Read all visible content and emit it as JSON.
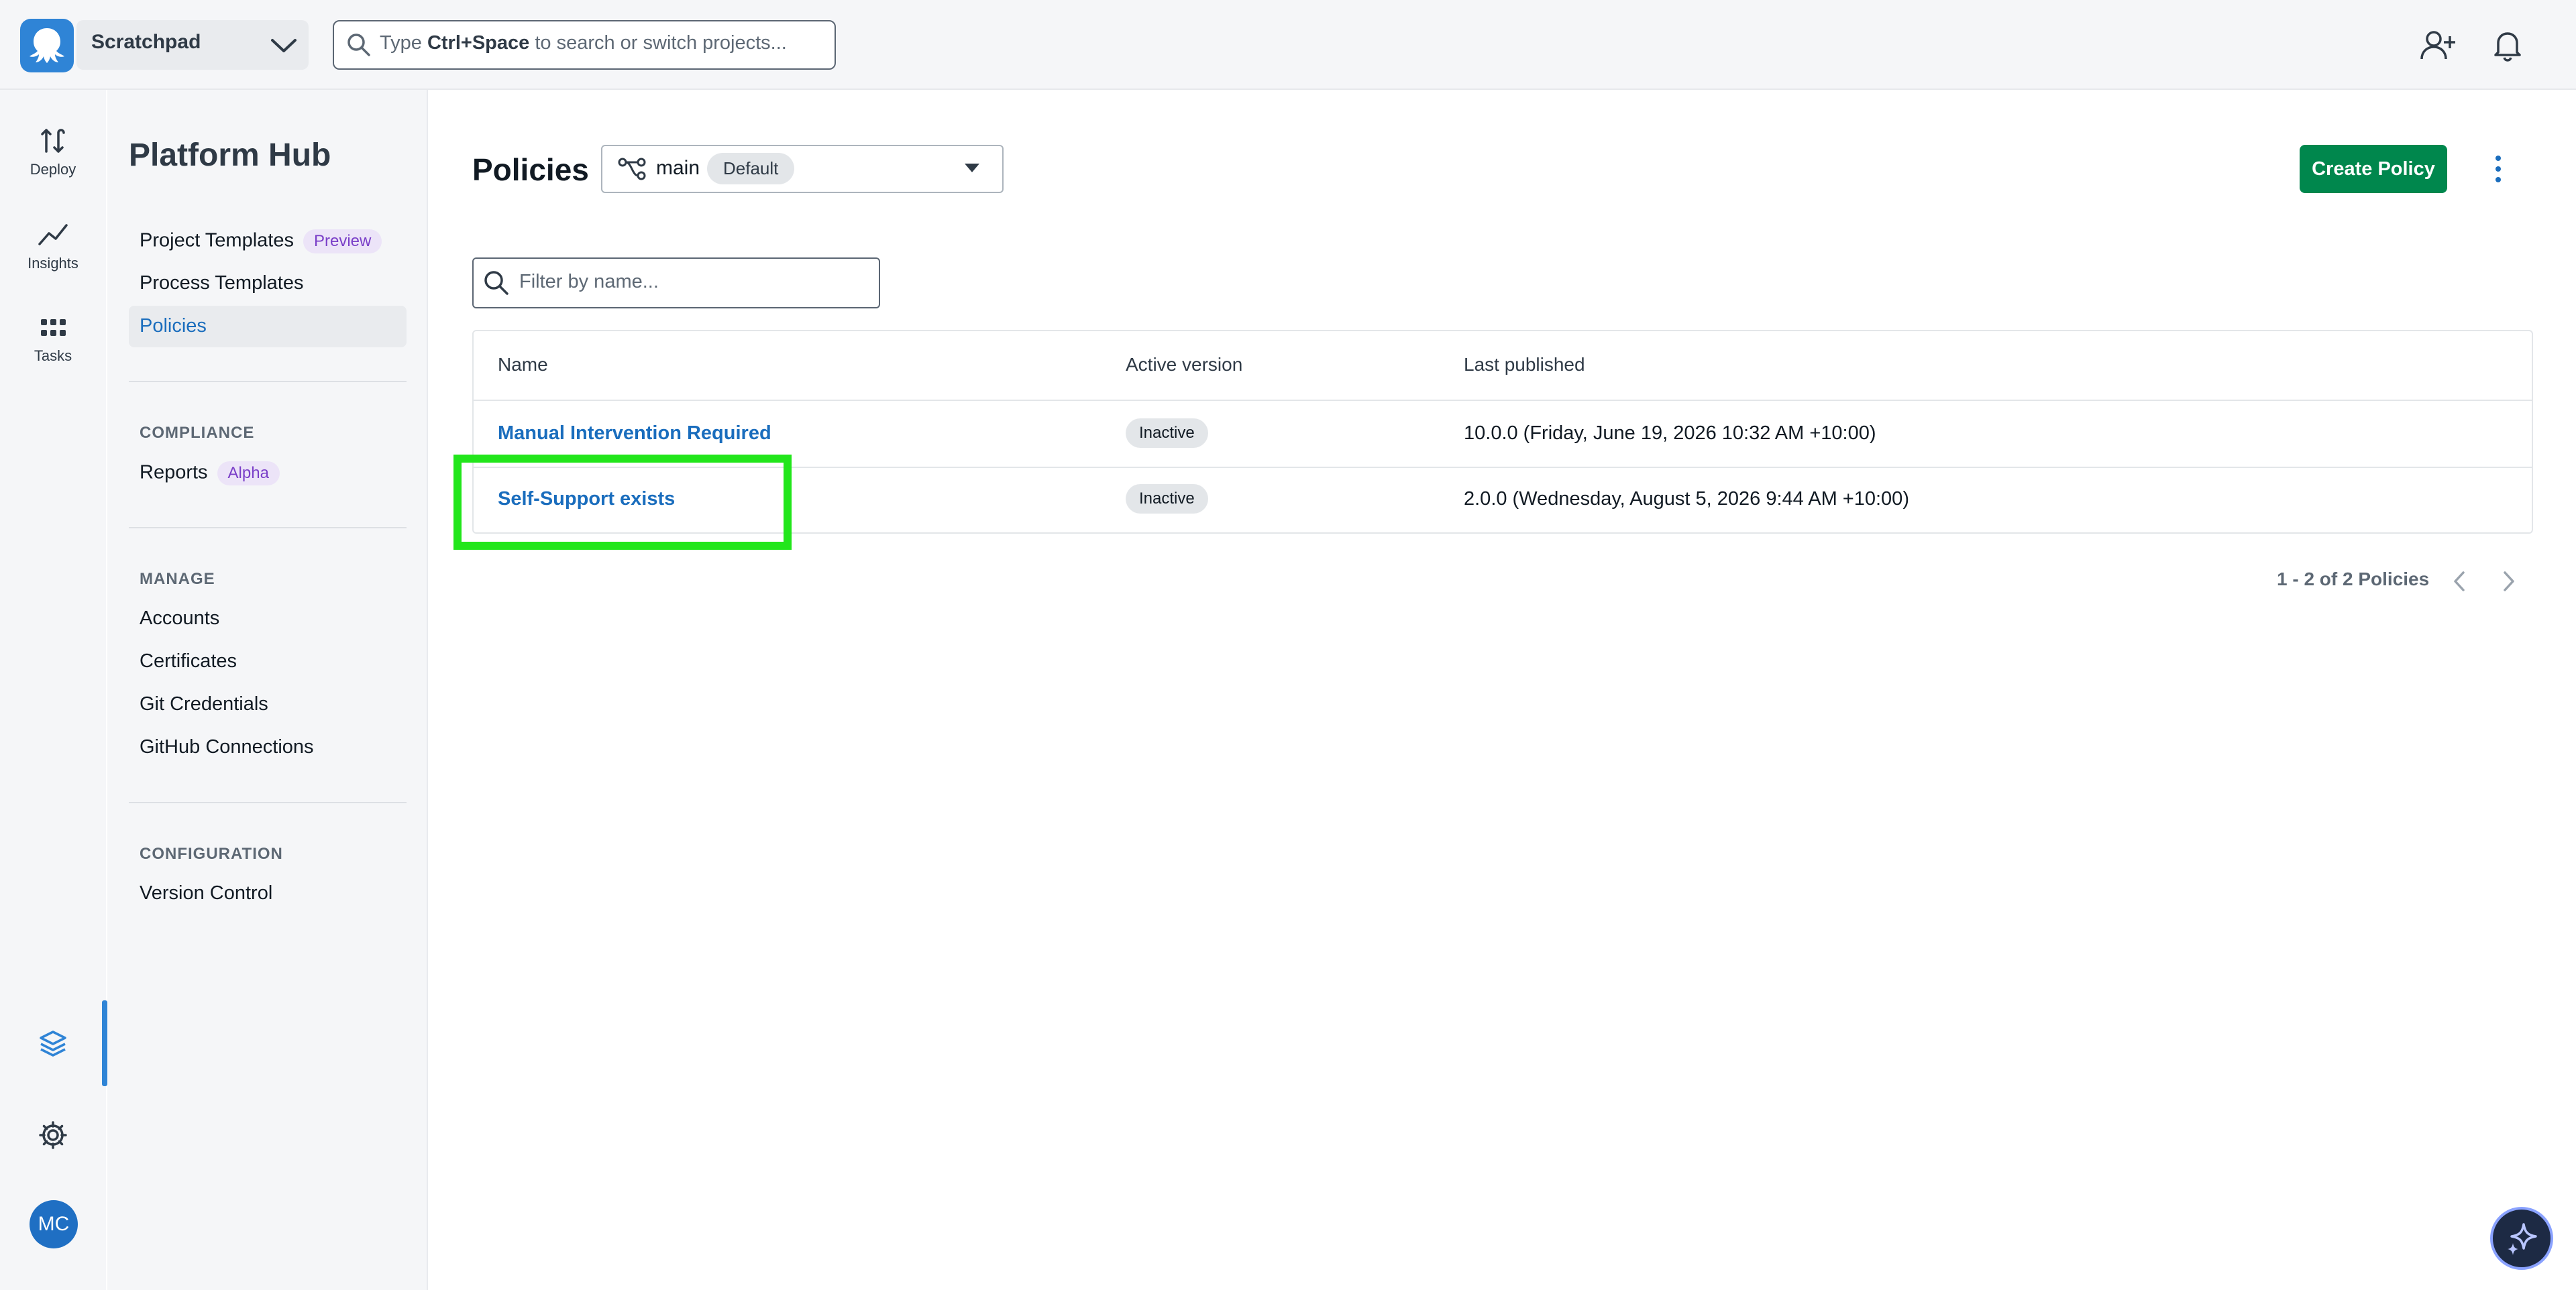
{
  "header": {
    "project_name": "Scratchpad",
    "search_prefix": "Type ",
    "search_shortcut": "Ctrl+Space",
    "search_suffix": " to search or switch projects..."
  },
  "rail": {
    "items": [
      {
        "label": "Deploy",
        "icon": "deploy-icon"
      },
      {
        "label": "Insights",
        "icon": "insights-icon"
      },
      {
        "label": "Tasks",
        "icon": "tasks-icon"
      }
    ],
    "avatar_initials": "MC"
  },
  "subnav": {
    "title": "Platform Hub",
    "items": [
      {
        "label": "Project Templates",
        "badge": "Preview"
      },
      {
        "label": "Process Templates"
      },
      {
        "label": "Policies"
      }
    ],
    "compliance": {
      "heading": "COMPLIANCE",
      "items": [
        {
          "label": "Reports",
          "badge": "Alpha"
        }
      ]
    },
    "manage": {
      "heading": "MANAGE",
      "items": [
        "Accounts",
        "Certificates",
        "Git Credentials",
        "GitHub Connections"
      ]
    },
    "configuration": {
      "heading": "CONFIGURATION",
      "items": [
        "Version Control"
      ]
    }
  },
  "main": {
    "title": "Policies",
    "branch": {
      "name": "main",
      "tag": "Default"
    },
    "create_button": "Create Policy",
    "filter_placeholder": "Filter by name...",
    "table": {
      "headers": [
        "Name",
        "Active version",
        "Last published"
      ],
      "rows": [
        {
          "name": "Manual Intervention Required",
          "status": "Inactive",
          "published": "10.0.0 (Friday, June 19, 2026 10:32 AM +10:00)"
        },
        {
          "name": "Self-Support exists",
          "status": "Inactive",
          "published": "2.0.0 (Wednesday, August 5, 2026 9:44 AM +10:00)"
        }
      ]
    },
    "pagination": "1 - 2 of 2 Policies"
  },
  "colors": {
    "accent": "#1a6dbd",
    "primary_button": "#00874d",
    "highlight": "#22e61b"
  }
}
